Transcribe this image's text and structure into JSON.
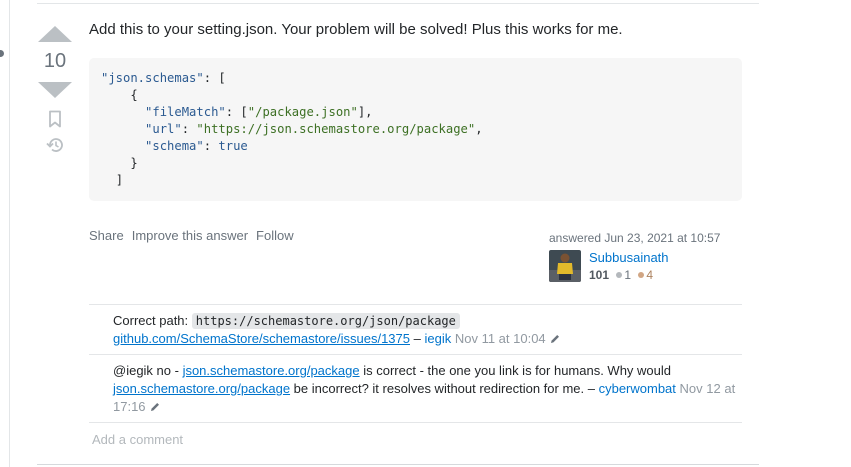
{
  "votes": {
    "score": "10"
  },
  "answer": {
    "text": "Add this to your setting.json. Your problem will be solved! Plus this works for me."
  },
  "code": {
    "key_schemas": "\"json.schemas\"",
    "key_filematch": "\"fileMatch\"",
    "val_filematch": "\"/package.json\"",
    "key_url": "\"url\"",
    "val_url": "\"https://json.schemastore.org/package\"",
    "key_schema": "\"schema\"",
    "val_schema": "true"
  },
  "post_menu": {
    "share": "Share",
    "improve": "Improve this answer",
    "follow": "Follow"
  },
  "user_card": {
    "answered": "answered Jun 23, 2021 at 10:57",
    "name": "Subbusainath",
    "reputation": "101",
    "silver_badges": "1",
    "bronze_badges": "4"
  },
  "comments": [
    {
      "prefix": "Correct path:",
      "code": "https://schemastore.org/json/package",
      "link": "github.com/SchemaStore/schemastore/issues/1375",
      "sep": " – ",
      "user": "iegik",
      "date": "Nov 11 at 10:04"
    },
    {
      "text1": "@iegik no - ",
      "link1": "json.schemastore.org/package",
      "text2": " is correct - the one you link is for humans. Why would ",
      "link2": "json.schemastore.org/package",
      "text3": " be incorrect? it resolves without redirection for me.",
      "sep": " – ",
      "user": "cyberwombat",
      "date": "Nov 12 at 17:16"
    }
  ],
  "add_comment": "Add a comment",
  "colors": {
    "link": "#0074cc",
    "vote_arrow": "#bbc0c4",
    "silver": "#b4b8bc",
    "bronze": "#d1a684"
  }
}
